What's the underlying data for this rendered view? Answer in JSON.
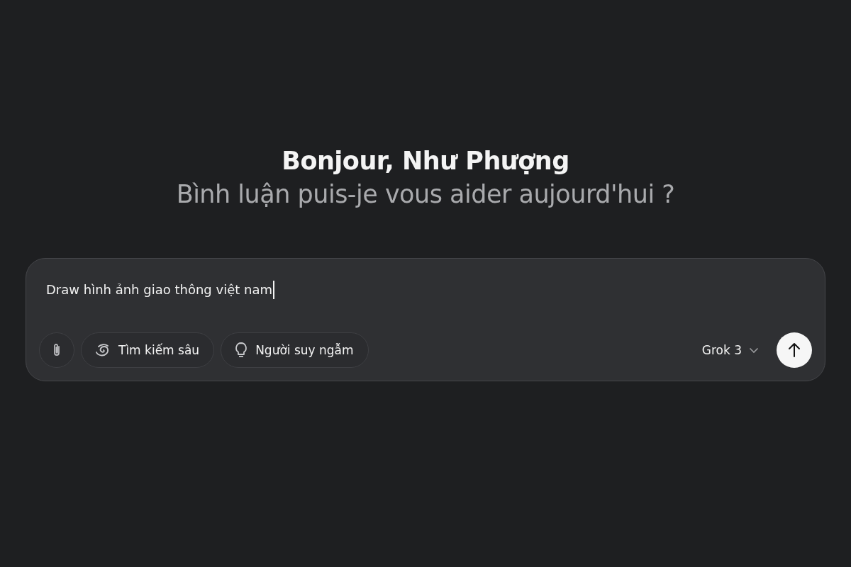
{
  "greeting": {
    "title": "Bonjour, Như Phượng",
    "subtitle": "Bình luận puis-je vous aider aujourd'hui ?"
  },
  "composer": {
    "value": "Draw hình ảnh giao thông việt nam",
    "tools": [
      {
        "kind": "attach"
      },
      {
        "kind": "deepsearch",
        "label": "Tìm kiếm sâu",
        "selected": false
      },
      {
        "kind": "think",
        "label": "Người suy ngẫm",
        "selected": false
      }
    ],
    "model": "Grok 3"
  }
}
